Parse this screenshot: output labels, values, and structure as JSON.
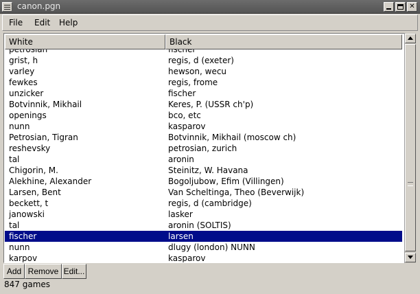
{
  "window": {
    "title": "canon.pgn"
  },
  "menubar": {
    "items": [
      "File",
      "Edit",
      "Help"
    ]
  },
  "table": {
    "columns": {
      "white": "White",
      "black": "Black"
    },
    "rows": [
      {
        "white": "petrosian",
        "black": "fischer"
      },
      {
        "white": "grist, h",
        "black": "regis, d (exeter)"
      },
      {
        "white": "varley",
        "black": "hewson, wecu"
      },
      {
        "white": "fewkes",
        "black": "regis, frome"
      },
      {
        "white": "unzicker",
        "black": "fischer"
      },
      {
        "white": "Botvinnik, Mikhail",
        "black": "Keres, P. (USSR ch'p)"
      },
      {
        "white": "openings",
        "black": "bco, etc"
      },
      {
        "white": "nunn",
        "black": "kasparov"
      },
      {
        "white": "Petrosian, Tigran",
        "black": "Botvinnik, Mikhail (moscow ch)"
      },
      {
        "white": "reshevsky",
        "black": "petrosian, zurich"
      },
      {
        "white": "tal",
        "black": "aronin"
      },
      {
        "white": "Chigorin, M.",
        "black": "Steinitz, W. Havana"
      },
      {
        "white": "Alekhine, Alexander",
        "black": "Bogoljubow, Efim (Villingen)"
      },
      {
        "white": "Larsen, Bent",
        "black": "Van Scheltinga, Theo (Beverwijk)"
      },
      {
        "white": "beckett, t",
        "black": "regis, d (cambridge)"
      },
      {
        "white": "janowski",
        "black": "lasker"
      },
      {
        "white": "tal",
        "black": "aronin (SOLTIS)"
      },
      {
        "white": "fischer",
        "black": "larsen",
        "selected": true
      },
      {
        "white": "nunn",
        "black": "dlugy (london) NUNN"
      },
      {
        "white": "karpov",
        "black": "kasparov"
      }
    ],
    "selection_color": "#000c8a"
  },
  "buttons": {
    "add": "Add",
    "remove": "Remove",
    "edit": "Edit..."
  },
  "status": {
    "text": "847 games"
  }
}
